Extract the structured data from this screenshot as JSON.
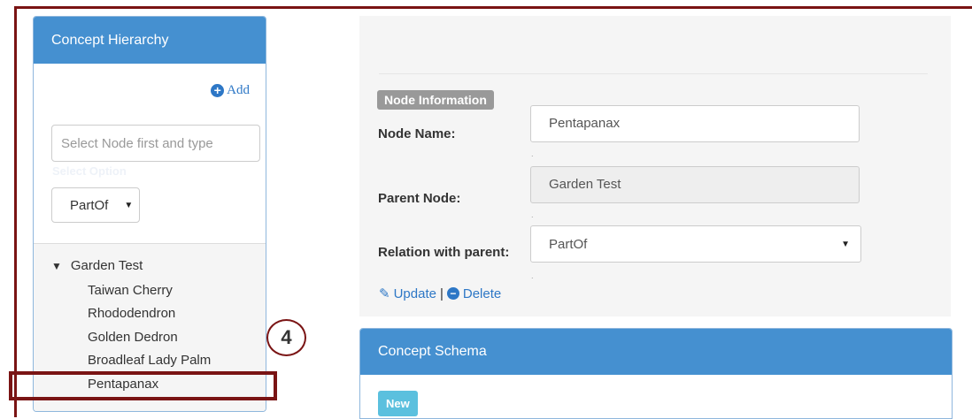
{
  "concept_hierarchy": {
    "title": "Concept Hierarchy",
    "add_label": "Add",
    "search_placeholder": "Select Node first and type",
    "select_option_label": "Select Option",
    "relation_select": "PartOf",
    "tree": {
      "root": "Garden Test",
      "children": [
        "Taiwan Cherry",
        "Rhododendron",
        "Golden Dedron",
        "Broadleaf Lady Palm",
        "Pentapanax"
      ]
    }
  },
  "annotation": {
    "step_number": "4",
    "frame_color": "#7a1414"
  },
  "node_information": {
    "badge": "Node Information",
    "node_name_label": "Node Name:",
    "node_name_value": "Pentapanax",
    "parent_node_label": "Parent Node:",
    "parent_node_value": "Garden Test",
    "relation_label": "Relation with parent:",
    "relation_value": "PartOf",
    "update_label": "Update",
    "separator": "|",
    "delete_label": "Delete"
  },
  "concept_schema": {
    "title": "Concept Schema",
    "new_label": "New"
  },
  "colors": {
    "header_blue": "#4590d0",
    "link_blue": "#2d77c6",
    "new_button": "#5bc0de"
  }
}
